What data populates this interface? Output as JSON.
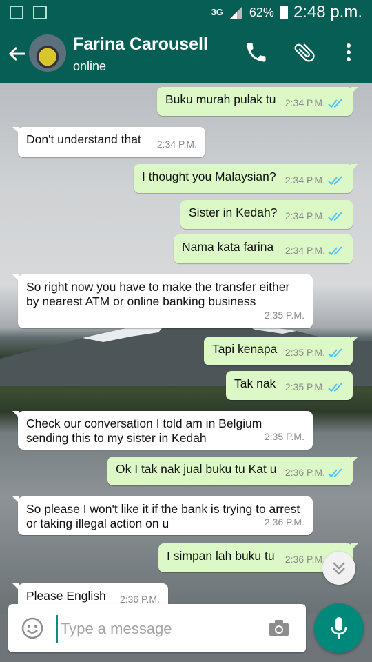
{
  "status_bar": {
    "network": "3G",
    "battery": "62%",
    "time": "2:48 p.m."
  },
  "header": {
    "contact_name": "Farina Carousell",
    "contact_status": "online",
    "icons": [
      "back-arrow-icon",
      "call-icon",
      "attach-icon",
      "more-options-icon"
    ]
  },
  "messages": [
    {
      "dir": "out",
      "text": "Buku murah pulak tu",
      "time": "2:34 P.M.",
      "read": true
    },
    {
      "dir": "in",
      "text": "Don't understand that",
      "time": "2:34 P.M."
    },
    {
      "dir": "out",
      "text": "I thought you Malaysian?",
      "time": "2:34 P.M.",
      "read": true
    },
    {
      "dir": "out",
      "text": "Sister in Kedah?",
      "time": "2:34 P.M.",
      "read": true
    },
    {
      "dir": "out",
      "text": "Nama kata farina",
      "time": "2:34 P.M.",
      "read": true
    },
    {
      "dir": "in",
      "text": "So right now you have to make the transfer either\nby nearest ATM or online banking business",
      "time": "2:35 P.M."
    },
    {
      "dir": "out",
      "text": "Tapi kenapa",
      "time": "2:35 P.M.",
      "read": true
    },
    {
      "dir": "out",
      "text": "Tak nak",
      "time": "2:35 P.M.",
      "read": true
    },
    {
      "dir": "in",
      "text": "Check our conversation I told am in Belgium\nsending this to my sister in Kedah",
      "time": "2:35 P.M."
    },
    {
      "dir": "out",
      "text": "Ok I tak nak jual buku tu Kat u",
      "time": "2:36 P.M.",
      "read": true
    },
    {
      "dir": "in",
      "text": "So please I won't like it if the bank is trying to arrest\nor taking illegal action on u",
      "time": "2:36 P.M."
    },
    {
      "dir": "out",
      "text": "I simpan lah buku tu",
      "time": "2:36 P.M.",
      "read": true
    },
    {
      "dir": "in",
      "text": "Please English",
      "time": "2:36 P.M."
    }
  ],
  "input": {
    "placeholder": "Type a message"
  },
  "colors": {
    "header": "#075e54",
    "outgoing_bubble": "#dcf8c6",
    "incoming_bubble": "#ffffff",
    "read_ticks": "#4fc3f7",
    "mic_button": "#00897b"
  }
}
